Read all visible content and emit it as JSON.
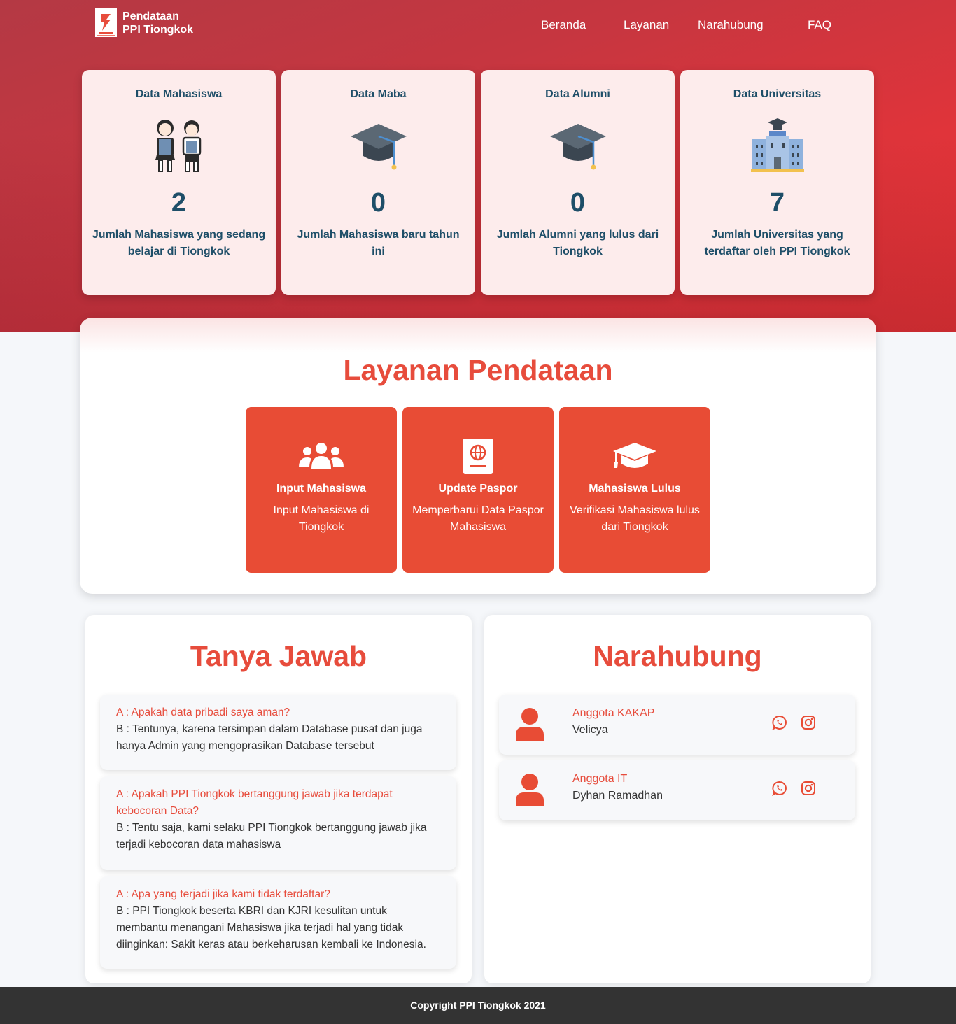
{
  "brand": {
    "line1": "Pendataan",
    "line2": "PPI Tiongkok",
    "logo": "ppi-logo-icon"
  },
  "nav": [
    "Beranda",
    "Layanan",
    "Narahubung",
    "FAQ"
  ],
  "stats": [
    {
      "title": "Data Mahasiswa",
      "icon": "students-icon",
      "value": "2",
      "desc": "Jumlah Mahasiswa yang sedang belajar di Tiongkok"
    },
    {
      "title": "Data Maba",
      "icon": "graduation-cap-icon",
      "value": "0",
      "desc": "Jumlah Mahasiswa baru tahun ini"
    },
    {
      "title": "Data Alumni",
      "icon": "graduation-cap-icon",
      "value": "0",
      "desc": "Jumlah Alumni yang lulus dari Tiongkok"
    },
    {
      "title": "Data Universitas",
      "icon": "university-building-icon",
      "value": "7",
      "desc": "Jumlah Universitas yang terdaftar oleh PPI Tiongkok"
    }
  ],
  "layanan": {
    "title": "Layanan Pendataan",
    "services": [
      {
        "title": "Input Mahasiswa",
        "desc": "Input Mahasiswa di Tiongkok",
        "icon": "users-icon"
      },
      {
        "title": "Update Paspor",
        "desc": "Memperbarui Data Paspor Mahasiswa",
        "icon": "passport-icon"
      },
      {
        "title": "Mahasiswa Lulus",
        "desc": "Verifikasi Mahasiswa lulus dari Tiongkok",
        "icon": "graduation-cap-icon"
      }
    ]
  },
  "faq": {
    "title": "Tanya Jawab",
    "items": [
      {
        "q": "A : Apakah data pribadi saya aman?",
        "a": "B : Tentunya, karena tersimpan dalam Database pusat dan juga hanya Admin yang mengoprasikan Database tersebut"
      },
      {
        "q": "A : Apakah PPI Tiongkok bertanggung jawab jika terdapat kebocoran Data?",
        "a": "B : Tentu saja, kami selaku PPI Tiongkok bertanggung jawab jika terjadi kebocoran data mahasiswa"
      },
      {
        "q": "A : Apa yang terjadi jika kami tidak terdaftar?",
        "a": "B : PPI Tiongkok beserta KBRI dan KJRI kesulitan untuk membantu menangani Mahasiswa jika terjadi hal yang tidak diinginkan: Sakit keras atau berkeharusan kembali ke Indonesia."
      }
    ]
  },
  "contacts": {
    "title": "Narahubung",
    "items": [
      {
        "role": "Anggota KAKAP",
        "name": "Velicya"
      },
      {
        "role": "Anggota IT",
        "name": "Dyhan Ramadhan"
      }
    ]
  },
  "footer": {
    "text": "Copyright PPI Tiongkok 2021"
  },
  "colors": {
    "accent": "#e74c3c",
    "navy": "#1e4e68",
    "card_bg": "#fdecec",
    "footer_bg": "#333333"
  }
}
